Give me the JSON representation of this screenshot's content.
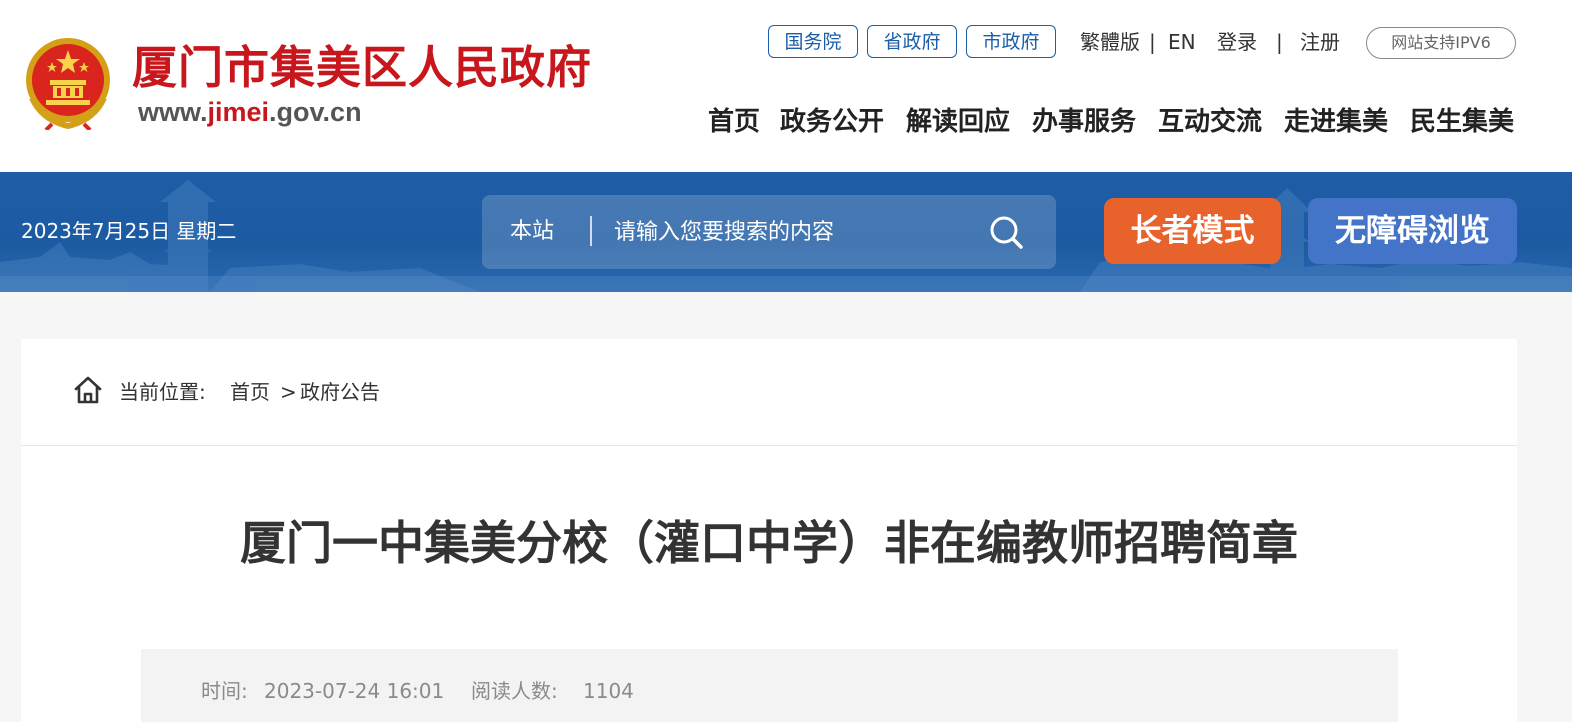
{
  "header": {
    "site_name": "厦门市集美区人民政府",
    "url_prefix": "www.",
    "url_mid": "jimei",
    "url_suffix": ".gov.cn",
    "gov_links": [
      "国务院",
      "省政府",
      "市政府"
    ],
    "traditional": "繁體版",
    "sep1": "|",
    "english": "EN",
    "login": "登录",
    "sep2": "|",
    "register": "注册",
    "ipv6_badge": "网站支持IPV6",
    "nav": [
      "首页",
      "政务公开",
      "解读回应",
      "办事服务",
      "互动交流",
      "走进集美",
      "民生集美"
    ]
  },
  "banner": {
    "date": "2023年7月25日 星期二",
    "search_scope": "本站",
    "search_placeholder": "请输入您要搜索的内容",
    "elder_mode": "长者模式",
    "accessible_browse": "无障碍浏览"
  },
  "breadcrumb": {
    "prefix": "当前位置:",
    "home": "首页",
    "sep": ">",
    "current": "政府公告"
  },
  "article": {
    "title": "厦门一中集美分校（灌口中学）非在编教师招聘简章",
    "time_label": "时间:",
    "time_value": "2023-07-24 16:01",
    "reads_label": "阅读人数:",
    "reads_value": "1104"
  },
  "colors": {
    "brand_red": "#c8161d",
    "brand_blue": "#1b5ea8",
    "banner_blue": "#1f5ea6",
    "elder_orange": "#e8622c",
    "a11y_blue": "#4374c8"
  },
  "icons": [
    "national-emblem-icon",
    "search-icon",
    "home-icon"
  ]
}
